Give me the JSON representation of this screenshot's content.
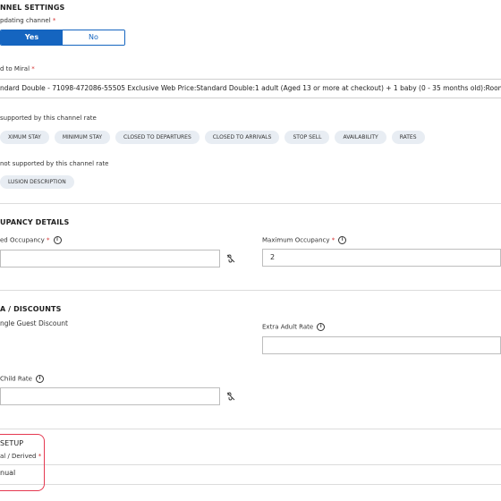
{
  "channel_settings": {
    "title": "NNEL SETTINGS",
    "updating_label": "pdating channel",
    "toggle": {
      "yes": "Yes",
      "no": "No"
    },
    "mapped_label": "d to Miral",
    "mapped_value": "ndard Double - 71098-472086-55505 Exclusive Web Price:Standard Double:1 adult (Aged 13 or more at checkout) + 1 baby (0 - 35 months old):Room Only",
    "supported_label": "supported by this channel rate",
    "supported_chips": [
      "XIMUM STAY",
      "MINIMUM STAY",
      "CLOSED TO DEPARTURES",
      "CLOSED TO ARRIVALS",
      "STOP SELL",
      "AVAILABILITY",
      "RATES"
    ],
    "not_supported_label": "not supported by this channel rate",
    "not_supported_chips": [
      "LUSION DESCRIPTION"
    ]
  },
  "occupancy": {
    "title": "UPANCY DETAILS",
    "included_label": "ed Occupancy",
    "included_value": "",
    "max_label": "Maximum Occupancy",
    "max_value": "2"
  },
  "discounts": {
    "title": "A / DISCOUNTS",
    "single_guest_label": "ngle Guest Discount",
    "extra_adult_label": "Extra Adult Rate",
    "extra_adult_value": "",
    "child_label": "Child Rate",
    "child_value": ""
  },
  "setup": {
    "title": "SETUP",
    "manual_derived_label": "al / Derived",
    "manual_derived_value": "nual"
  },
  "required_marker": "*",
  "info_glyph": "i",
  "colors": {
    "accent": "#1565c0",
    "required": "#d32f2f",
    "highlight": "#e53950",
    "chip_bg": "#e8edf3"
  }
}
